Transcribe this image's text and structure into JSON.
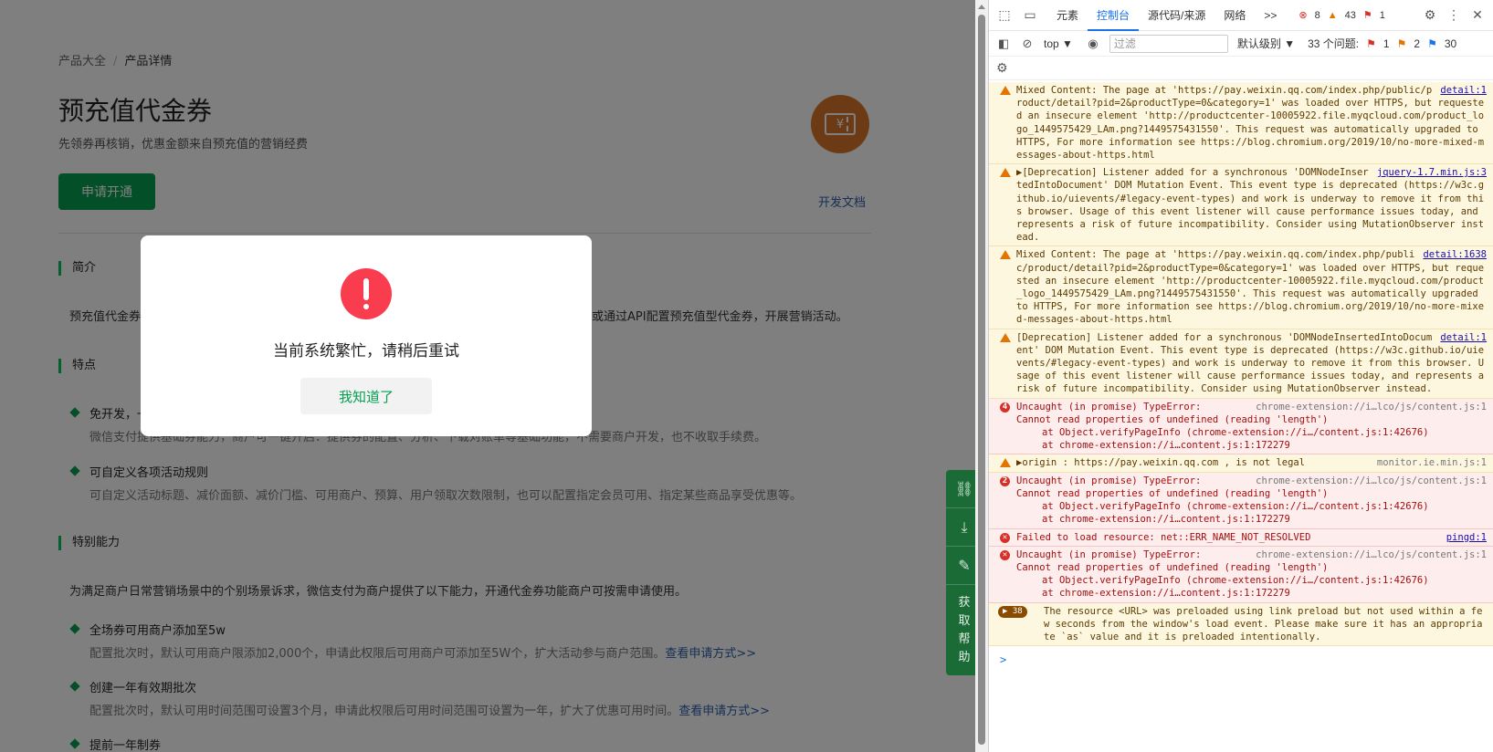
{
  "page": {
    "breadcrumb": {
      "parent": "产品大全",
      "separator": "/",
      "current": "产品详情"
    },
    "title": "预充值代金券",
    "subtitle": "先领券再核销，优惠金额来自预充值的营销经费",
    "icon_symbol": "¥",
    "apply_button": "申请开通",
    "dev_doc_link": "开发文档",
    "sections": {
      "intro": {
        "title": "简介",
        "text": "预充值代金券是商户提前充值营销资金，微信支付为商户提供预充值代金券能力，商户可在商户平台或通过API配置预充值型代金券，开展营销活动。"
      },
      "features": {
        "title": "特点",
        "items": [
          {
            "title": "免开发，一键配置即可使用",
            "desc": "微信支付提供基础券能力，商户可一键开启：提供券的配置、分析、下载对账单等基础功能，不需要商户开发，也不收取手续费。"
          },
          {
            "title": "可自定义各项活动规则",
            "desc": "可自定义活动标题、减价面额、减价门槛、可用商户、预算、用户领取次数限制，也可以配置指定会员可用、指定某些商品享受优惠等。"
          }
        ]
      },
      "special": {
        "title": "特别能力",
        "intro": "为满足商户日常营销场景中的个别场景诉求，微信支付为商户提供了以下能力，开通代金券功能商户可按需申请使用。",
        "items": [
          {
            "title": "全场券可用商户添加至5w",
            "desc": "配置批次时，默认可用商户限添加2,000个，申请此权限后可用商户可添加至5W个，扩大活动参与商户范围。",
            "link": "查看申请方式>>"
          },
          {
            "title": "创建一年有效期批次",
            "desc": "配置批次时，默认可用时间范围可设置3个月，申请此权限后可用时间范围可设置为一年，扩大了优惠可用时间。",
            "link": "查看申请方式>>"
          },
          {
            "title": "提前一年制券",
            "desc": "",
            "link": ""
          }
        ]
      }
    },
    "helpbar": {
      "icons": [
        "link-icon",
        "download-icon",
        "edit-icon"
      ],
      "help_text": "获取帮助"
    }
  },
  "modal": {
    "message": "当前系统繁忙，请稍后重试",
    "button": "我知道了"
  },
  "devtools": {
    "tabs": [
      "元素",
      "控制台",
      "源代码/来源",
      "网络"
    ],
    "active_tab": "控制台",
    "more_tabs": ">>",
    "counts": {
      "errors": "8",
      "warnings": "43",
      "issues": "1"
    },
    "toolbar": {
      "context": "top ▼",
      "filter_placeholder": "过滤",
      "level": "默认级别 ▼",
      "issues_label": "33 个问题:",
      "issue_counts": [
        "1",
        "2",
        "30"
      ]
    },
    "messages": [
      {
        "type": "warn",
        "src": "detail:1",
        "text": "Mixed Content: The page at 'https://pay.weixin.qq.com/index.php/public/product/detail?pid=2&productType=0&category=1' was loaded over HTTPS, but requested an insecure element 'http://productcenter-10005922.file.myqcloud.com/product_logo_1449575429_LAm.png?1449575431550'. This request was automatically upgraded to HTTPS, For more information see https://blog.chromium.org/2019/10/no-more-mixed-messages-about-https.html"
      },
      {
        "type": "warn",
        "src": "jquery-1.7.min.js:3",
        "text": "▶[Deprecation] Listener added for a synchronous 'DOMNodeInsertedIntoDocument' DOM Mutation Event. This event type is deprecated (https://w3c.github.io/uievents/#legacy-event-types) and work is underway to remove it from this browser. Usage of this event listener will cause performance issues today, and represents a risk of future incompatibility. Consider using MutationObserver instead."
      },
      {
        "type": "warn",
        "src": "detail:1638",
        "text": "Mixed Content: The page at 'https://pay.weixin.qq.com/index.php/public/product/detail?pid=2&productType=0&category=1' was loaded over HTTPS, but requested an insecure element 'http://productcenter-10005922.file.myqcloud.com/product_logo_1449575429_LAm.png?1449575431550'. This request was automatically upgraded to HTTPS, For more information see https://blog.chromium.org/2019/10/no-more-mixed-messages-about-https.html"
      },
      {
        "type": "warn",
        "src": "detail:1",
        "text": "[Deprecation] Listener added for a synchronous 'DOMNodeInsertedIntoDocument' DOM Mutation Event. This event type is deprecated (https://w3c.github.io/uievents/#legacy-event-types) and work is underway to remove it from this browser. Usage of this event listener will cause performance issues today, and represents a risk of future incompatibility. Consider using MutationObserver instead."
      },
      {
        "type": "err",
        "badge": "4",
        "src": "chrome-extension://i…lco/js/content.js:1",
        "src_plain": true,
        "text": "Uncaught (in promise) TypeError:\nCannot read properties of undefined (reading 'length')",
        "at": [
          "at Object.verifyPageInfo (chrome-extension://i…/content.js:1:42676)",
          "at chrome-extension://i…content.js:1:172279"
        ]
      },
      {
        "type": "warn",
        "src": "monitor.ie.min.js:1",
        "src_plain": true,
        "text": "▶origin : https://pay.weixin.qq.com , is not legal"
      },
      {
        "type": "err",
        "badge": "2",
        "src": "chrome-extension://i…lco/js/content.js:1",
        "src_plain": true,
        "text": "Uncaught (in promise) TypeError:\nCannot read properties of undefined (reading 'length')",
        "at": [
          "at Object.verifyPageInfo (chrome-extension://i…/content.js:1:42676)",
          "at chrome-extension://i…content.js:1:172279"
        ]
      },
      {
        "type": "err",
        "src": "pingd:1",
        "text": "Failed to load resource: net::ERR_NAME_NOT_RESOLVED"
      },
      {
        "type": "err",
        "src": "chrome-extension://i…lco/js/content.js:1",
        "src_plain": true,
        "text": "Uncaught (in promise) TypeError:\nCannot read properties of undefined (reading 'length')",
        "at": [
          "at Object.verifyPageInfo (chrome-extension://i…/content.js:1:42676)",
          "at chrome-extension://i…content.js:1:172279"
        ]
      },
      {
        "type": "warn",
        "count": "38",
        "src": "",
        "text": "The resource <URL> was preloaded using link preload but not used within a few seconds from the window's load event. Please make sure it has an appropriate `as` value and it is preloaded intentionally."
      }
    ],
    "prompt": ">"
  }
}
